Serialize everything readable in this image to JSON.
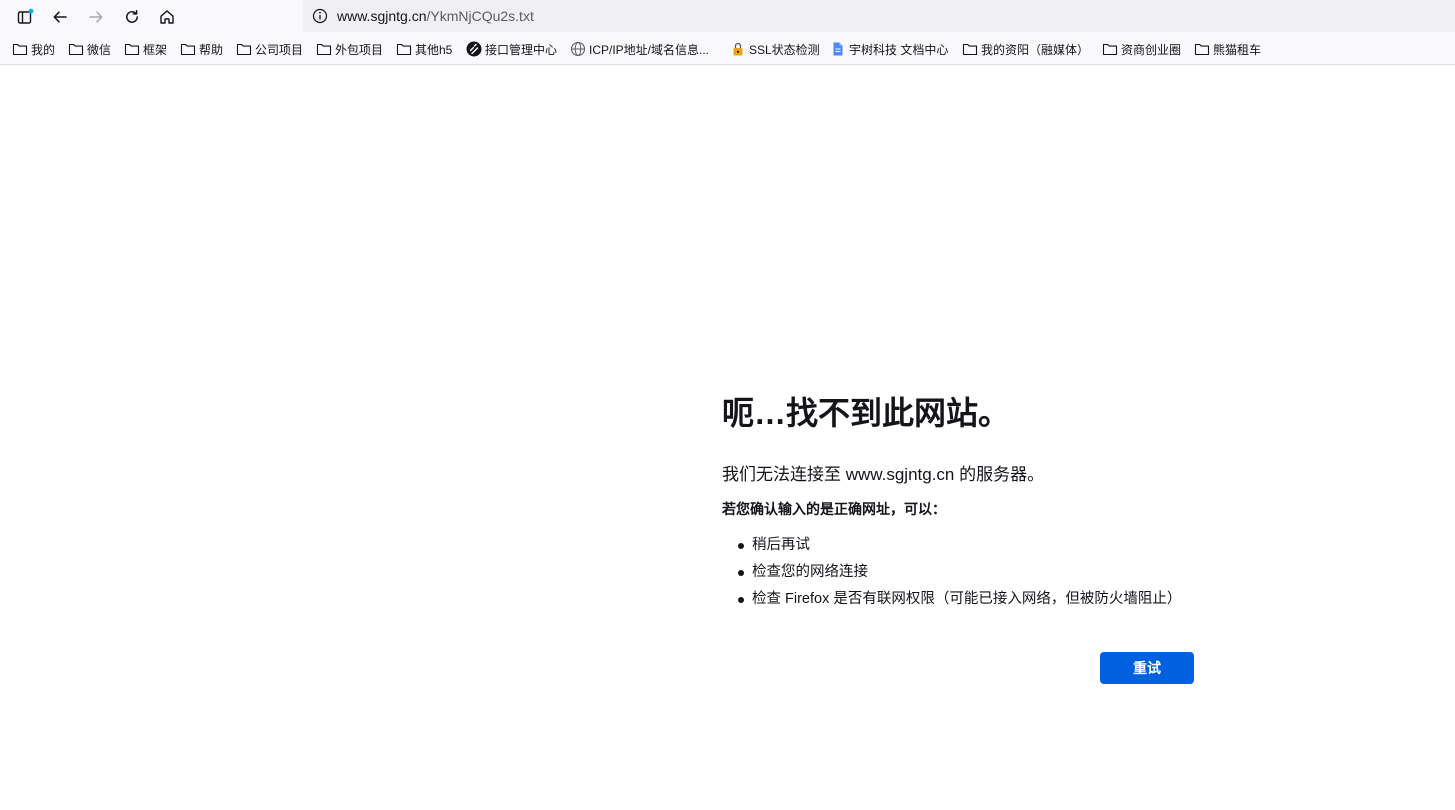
{
  "toolbar": {
    "buttons": [
      {
        "name": "sidebar-icon"
      },
      {
        "name": "back-arrow-icon"
      },
      {
        "name": "forward-arrow-icon"
      },
      {
        "name": "reload-icon"
      },
      {
        "name": "home-icon"
      }
    ],
    "url": {
      "host": "www.sgjntg.cn",
      "path": "/YkmNjCQu2s.txt"
    }
  },
  "bookmarks": [
    {
      "label": "我的",
      "icon": "folder-icon"
    },
    {
      "label": "微信",
      "icon": "folder-icon"
    },
    {
      "label": "框架",
      "icon": "folder-icon"
    },
    {
      "label": "帮助",
      "icon": "folder-icon"
    },
    {
      "label": "公司项目",
      "icon": "folder-icon"
    },
    {
      "label": "外包项目",
      "icon": "folder-icon"
    },
    {
      "label": "其他h5",
      "icon": "folder-icon"
    },
    {
      "label": "接口管理中心",
      "icon": "api-logo-icon"
    },
    {
      "label": "ICP/IP地址/域名信息...",
      "icon": "globe-icon"
    },
    {
      "label": "SSL状态检测",
      "icon": "ssl-lock-icon"
    },
    {
      "label": "宇树科技 文档中心",
      "icon": "document-icon"
    },
    {
      "label": "我的资阳（融媒体）",
      "icon": "folder-icon"
    },
    {
      "label": "资商创业圈",
      "icon": "folder-icon"
    },
    {
      "label": "熊猫租车",
      "icon": "folder-icon"
    }
  ],
  "error": {
    "title": "呃…找不到此网站。",
    "description": "我们无法连接至 www.sgjntg.cn 的服务器。",
    "subtitle": "若您确认输入的是正确网址，可以：",
    "suggestions": [
      "稍后再试",
      "检查您的网络连接",
      "检查 Firefox 是否有联网权限（可能已接入网络，但被防火墙阻止）"
    ],
    "retry_label": "重试"
  },
  "colors": {
    "accent": "#0061e0",
    "chrome_bg": "#f9f9fb",
    "urlbar_bg": "#f0f0f4",
    "text": "#15141a"
  }
}
